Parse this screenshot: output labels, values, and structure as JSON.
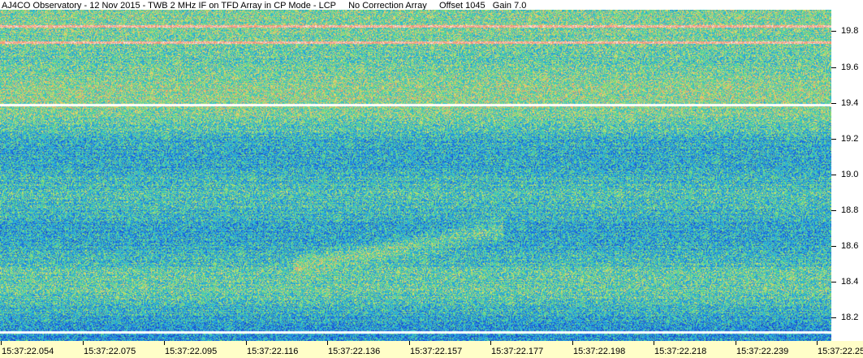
{
  "title": "AJ4CO Observatory - 12 Nov 2015 - TWB 2 MHz IF on TFD Array in CP Mode - LCP     No Correction Array     Offset 1045   Gain 7.0",
  "chart_data": {
    "type": "heatmap",
    "title": "AJ4CO Observatory - 12 Nov 2015 - TWB 2 MHz IF on TFD Array in CP Mode - LCP     No Correction Array     Offset 1045   Gain 7.0",
    "xlabel": "",
    "ylabel": "",
    "x_tick_labels": [
      "15:37:22.054",
      "15:37:22.075",
      "15:37:22.095",
      "15:37:22.116",
      "15:37:22.136",
      "15:37:22.157",
      "15:37:22.177",
      "15:37:22.198",
      "15:37:22.218",
      "15:37:22.239",
      "15:37:22.259"
    ],
    "y_tick_labels": [
      "18.2",
      "18.4",
      "18.6",
      "18.8",
      "19.0",
      "19.2",
      "19.4",
      "19.6",
      "19.8"
    ],
    "y_ticks": [
      18.2,
      18.4,
      18.6,
      18.8,
      19.0,
      19.2,
      19.4,
      19.6,
      19.8
    ],
    "ylim": [
      18.07,
      19.92
    ],
    "y_axis_side": "right",
    "colormap": [
      "#1a3cc8",
      "#1f7ee6",
      "#2cc0d8",
      "#6adc7a",
      "#e8dc6a",
      "#f08a70",
      "#ffffff"
    ],
    "interference_lines_freq": [
      19.83,
      19.74,
      19.39,
      18.12
    ]
  }
}
